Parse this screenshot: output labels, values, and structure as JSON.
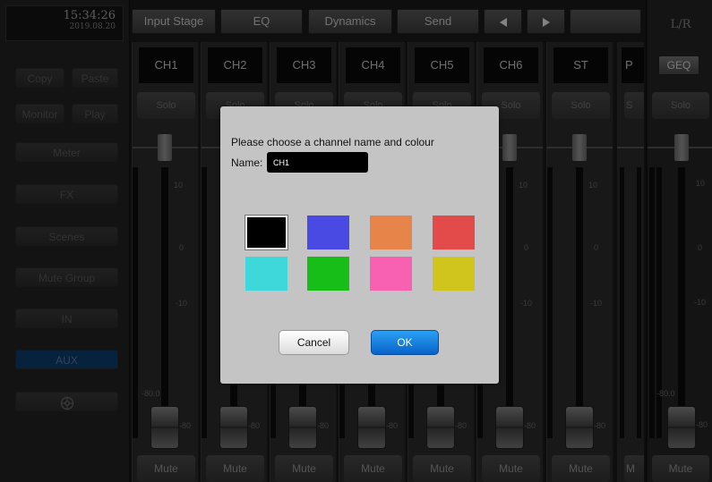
{
  "clock": {
    "time": "15:34:26",
    "date": "2019.08.20"
  },
  "topbar": {
    "input_stage": "Input Stage",
    "eq": "EQ",
    "dynamics": "Dynamics",
    "send": "Send",
    "prev_icon": "left-triangle-icon",
    "next_icon": "right-triangle-icon"
  },
  "sidebar": {
    "copy": "Copy",
    "paste": "Paste",
    "monitor": "Monitor",
    "play": "Play",
    "meter": "Meter",
    "fx": "FX",
    "scenes": "Scenes",
    "mute_group": "Mute Group",
    "in": "IN",
    "aux": "AUX",
    "settings_icon": "gear-icon"
  },
  "strips": [
    {
      "name": "CH1",
      "solo": "Solo",
      "mute": "Mute"
    },
    {
      "name": "CH2",
      "solo": "Solo",
      "mute": "Mute"
    },
    {
      "name": "CH3",
      "solo": "Solo",
      "mute": "Mute"
    },
    {
      "name": "CH4",
      "solo": "Solo",
      "mute": "Mute"
    },
    {
      "name": "CH5",
      "solo": "Solo",
      "mute": "Mute"
    },
    {
      "name": "CH6",
      "solo": "Solo",
      "mute": "Mute"
    },
    {
      "name": "ST",
      "solo": "Solo",
      "mute": "Mute"
    }
  ],
  "partial_strip": {
    "name": "P",
    "solo": "S",
    "mute": "M"
  },
  "scale": {
    "plus10": "10",
    "zero": "0",
    "minus10": "-10",
    "minus80": "-80",
    "minus80_1": "-80.0"
  },
  "right": {
    "lr": "L/R",
    "geq": "GEQ",
    "solo": "Solo",
    "mute": "Mute"
  },
  "dialog": {
    "prompt": "Please choose a channel name and colour",
    "name_label": "Name:",
    "name_value": "CH1",
    "cancel": "Cancel",
    "ok": "OK",
    "colors": [
      "#000000",
      "#4949e4",
      "#e6844a",
      "#e34a4a",
      "#3fd8da",
      "#17be17",
      "#f860b2",
      "#cfc51d"
    ],
    "selected_color": "#000000"
  }
}
